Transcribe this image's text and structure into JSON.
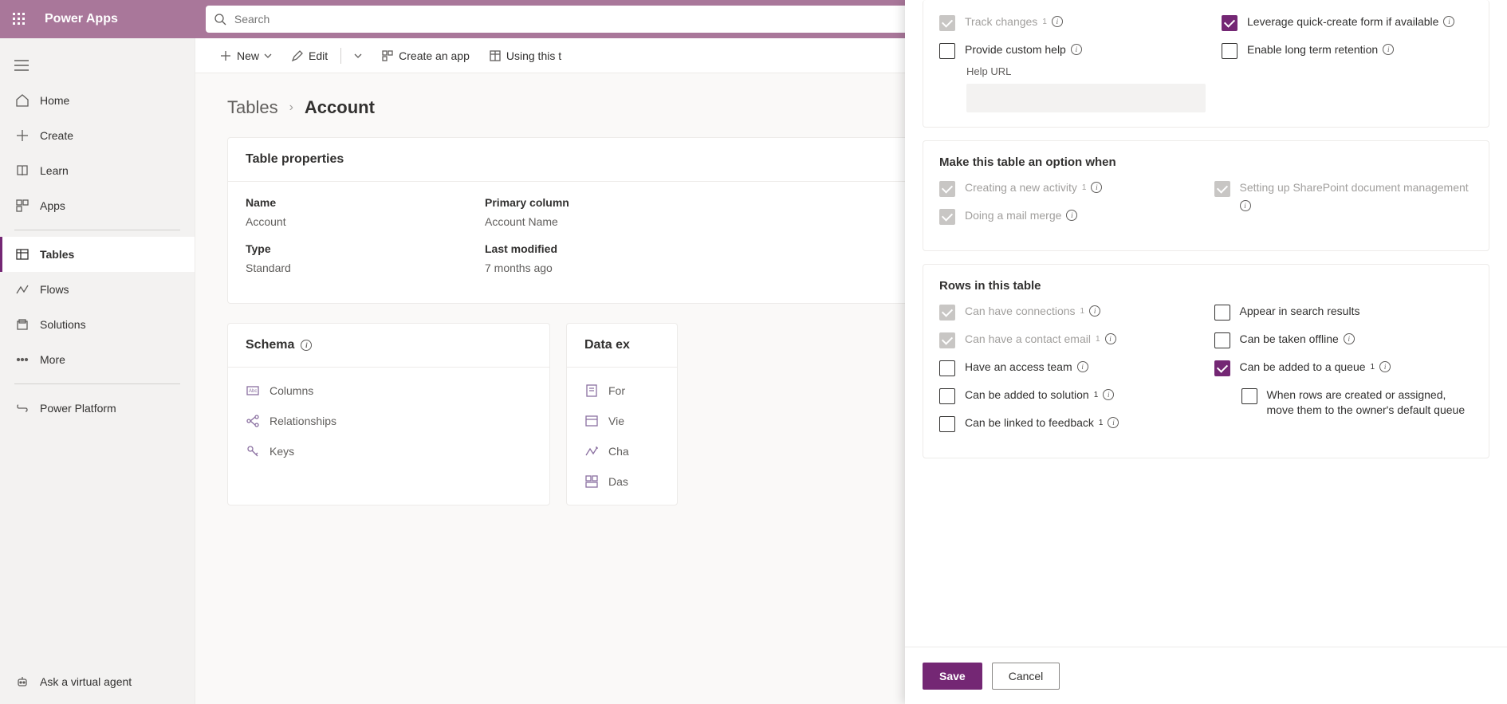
{
  "header": {
    "app_title": "Power Apps",
    "search_placeholder": "Search"
  },
  "nav": {
    "home": "Home",
    "create": "Create",
    "learn": "Learn",
    "apps": "Apps",
    "tables": "Tables",
    "flows": "Flows",
    "solutions": "Solutions",
    "more": "More",
    "power_platform": "Power Platform",
    "ask": "Ask a virtual agent"
  },
  "cmdbar": {
    "new": "New",
    "edit": "Edit",
    "create_app": "Create an app",
    "using_table": "Using this t"
  },
  "breadcrumb": {
    "root": "Tables",
    "current": "Account"
  },
  "props_card": {
    "title": "Table properties",
    "name_label": "Name",
    "name_value": "Account",
    "type_label": "Type",
    "type_value": "Standard",
    "primary_label": "Primary column",
    "primary_value": "Account Name",
    "modified_label": "Last modified",
    "modified_value": "7 months ago"
  },
  "schema_card": {
    "title": "Schema",
    "columns": "Columns",
    "relationships": "Relationships",
    "keys": "Keys"
  },
  "data_card": {
    "title": "Data ex",
    "forms": "For",
    "views": "Vie",
    "charts": "Cha",
    "dashboards": "Das"
  },
  "panel": {
    "sec1": {
      "track_changes": "Track changes",
      "provide_help": "Provide custom help",
      "help_url": "Help URL",
      "leverage_quick": "Leverage quick-create form if available",
      "long_term": "Enable long term retention"
    },
    "sec2": {
      "title": "Make this table an option when",
      "new_activity": "Creating a new activity",
      "mail_merge": "Doing a mail merge",
      "sharepoint": "Setting up SharePoint document management"
    },
    "sec3": {
      "title": "Rows in this table",
      "connections": "Can have connections",
      "contact_email": "Can have a contact email",
      "access_team": "Have an access team",
      "solution": "Can be added to solution",
      "feedback": "Can be linked to feedback",
      "search": "Appear in search results",
      "offline": "Can be taken offline",
      "queue": "Can be added to a queue",
      "queue_sub": "When rows are created or assigned, move them to the owner's default queue"
    },
    "save": "Save",
    "cancel": "Cancel"
  }
}
